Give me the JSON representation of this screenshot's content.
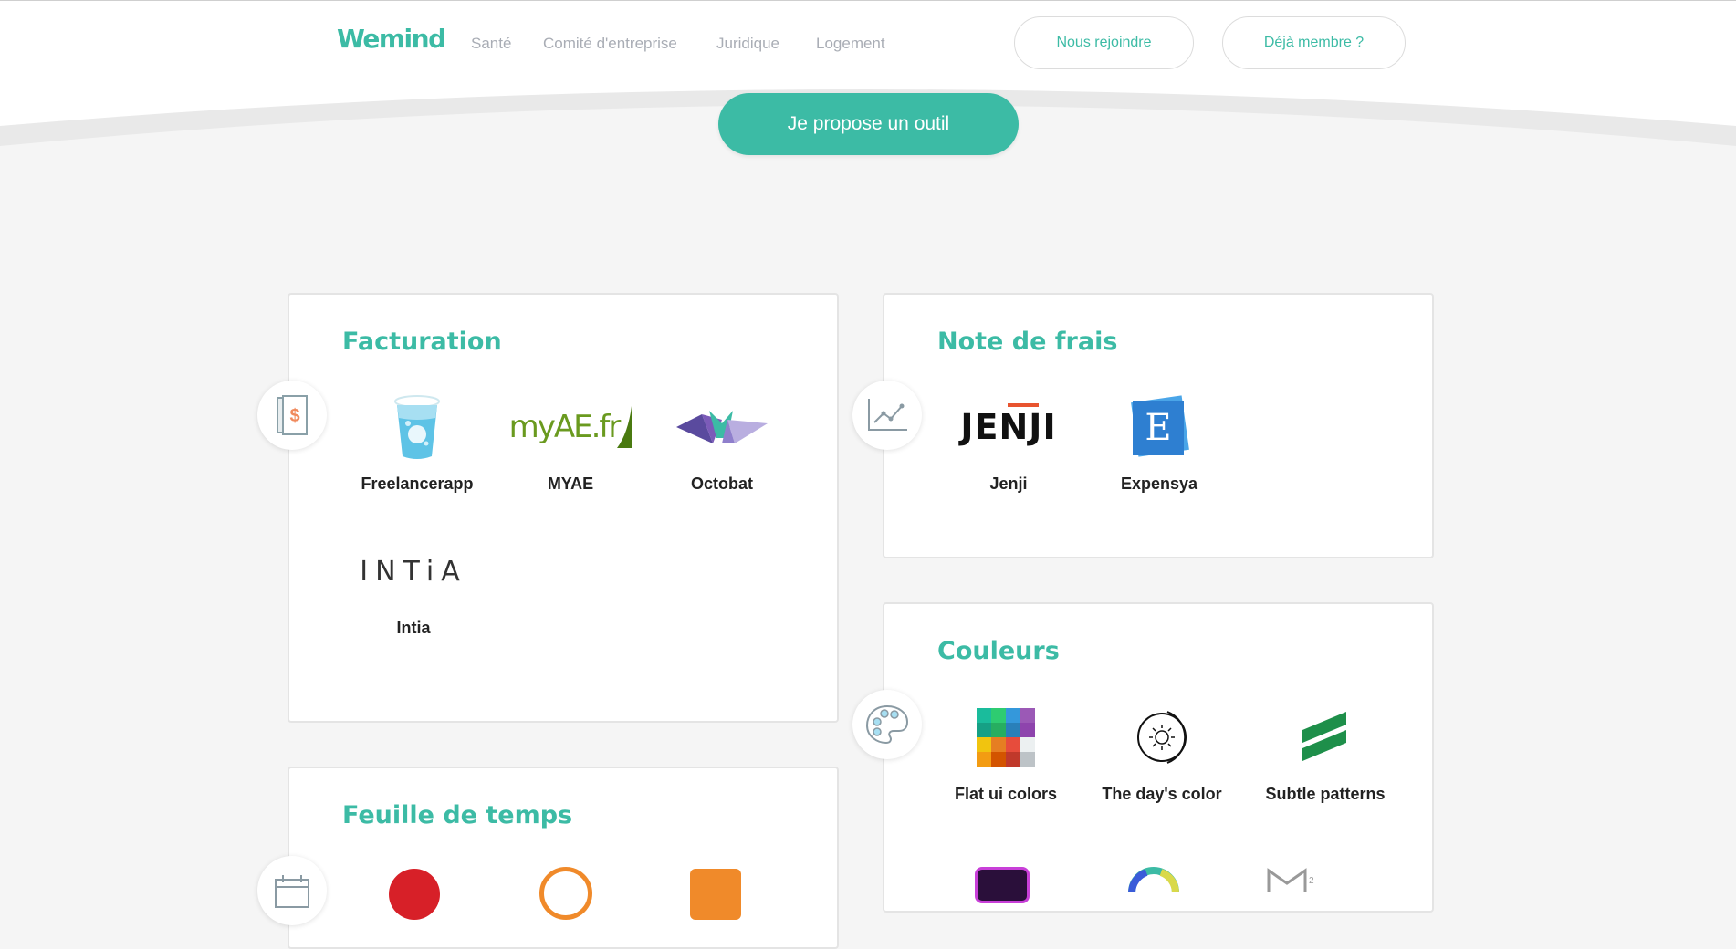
{
  "header": {
    "logo": "Wemind",
    "nav": [
      "Santé",
      "Comité d'entreprise",
      "Juridique",
      "Logement"
    ],
    "join_label": "Nous rejoindre",
    "member_label": "Déjà membre ?",
    "cta_label": "Je propose un outil"
  },
  "colors": {
    "accent": "#3cbba5",
    "nav_text": "#a9adb5",
    "background": "#f5f5f5"
  },
  "cards": {
    "facturation": {
      "title": "Facturation",
      "icon": "invoice-icon",
      "tools": [
        {
          "name": "Freelancerapp",
          "logo_icon": "water-glass-icon"
        },
        {
          "name": "MYAE",
          "logo_text": "myAE.fr"
        },
        {
          "name": "Octobat",
          "logo_icon": "octobat-icon"
        },
        {
          "name": "Intia",
          "logo_text": "INTiA"
        }
      ]
    },
    "notes": {
      "title": "Note de frais",
      "icon": "line-chart-icon",
      "tools": [
        {
          "name": "Jenji",
          "logo_text": "JENJI"
        },
        {
          "name": "Expensya",
          "logo_text": "E"
        }
      ]
    },
    "temps": {
      "title": "Feuille de temps",
      "icon": "calendar-icon"
    },
    "couleurs": {
      "title": "Couleurs",
      "icon": "palette-icon",
      "tools": [
        {
          "name": "Flat ui colors",
          "logo_icon": "color-grid-icon"
        },
        {
          "name": "The day's color",
          "logo_icon": "sun-icon"
        },
        {
          "name": "Subtle patterns",
          "logo_icon": "stripes-icon"
        }
      ]
    }
  }
}
